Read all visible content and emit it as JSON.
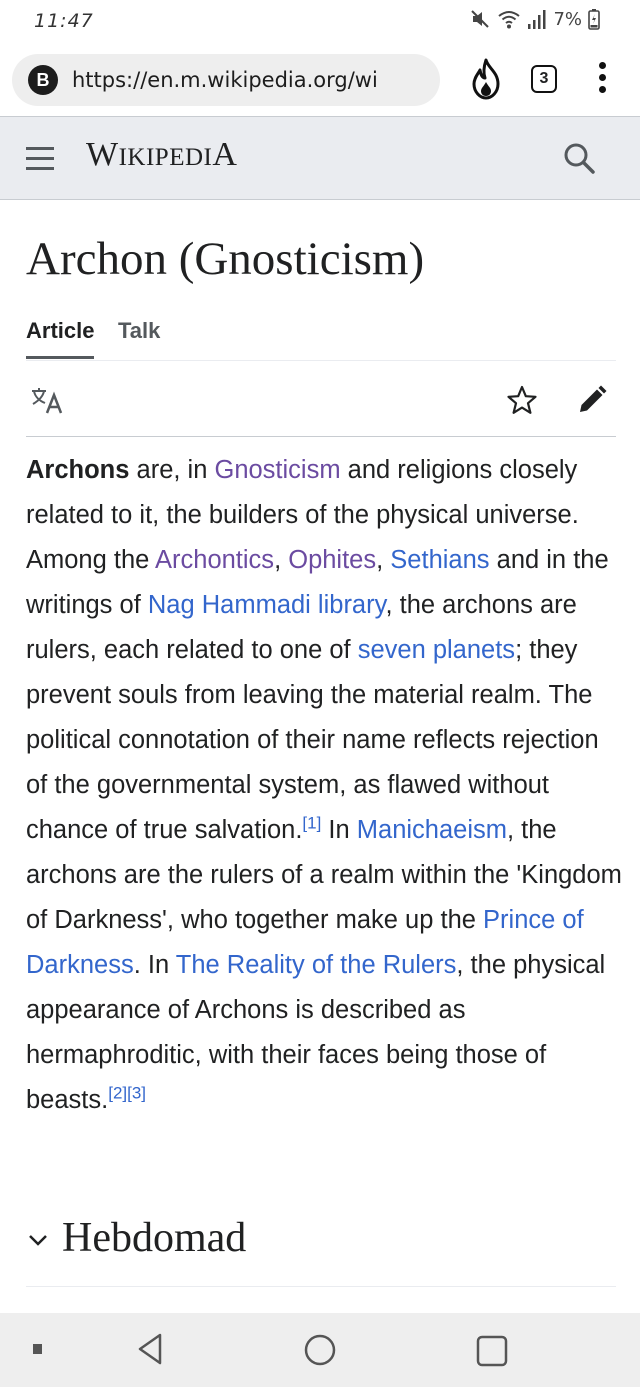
{
  "status": {
    "time": "11:47",
    "battery": "7%"
  },
  "browser": {
    "site_badge": "B",
    "url": "https://en.m.wikipedia.org/wi",
    "tab_count": "3"
  },
  "header": {
    "wordmark_first": "W",
    "wordmark_rest": "IKIPEDI",
    "wordmark_last": "A"
  },
  "page": {
    "title": "Archon (Gnosticism)",
    "tabs": [
      {
        "label": "Article",
        "active": true
      },
      {
        "label": "Talk",
        "active": false
      }
    ]
  },
  "content": {
    "segments": [
      {
        "text": "Archons",
        "bold": true
      },
      {
        "text": " are, in "
      },
      {
        "text": "Gnosticism",
        "link": true,
        "visited": true
      },
      {
        "text": " and religions closely related to it, the builders of the physical universe. Among the "
      },
      {
        "text": "Archontics",
        "link": true,
        "visited": true
      },
      {
        "text": ", "
      },
      {
        "text": "Ophites",
        "link": true,
        "visited": true
      },
      {
        "text": ", "
      },
      {
        "text": "Sethians",
        "link": true
      },
      {
        "text": " and in the writings of "
      },
      {
        "text": "Nag Hammadi library",
        "link": true
      },
      {
        "text": ", the archons are rulers, each related to one of "
      },
      {
        "text": "seven planets",
        "link": true
      },
      {
        "text": "; they prevent souls from leaving the material realm. The political connotation of their name reflects rejection of the governmental system, as flawed without chance of true salvation."
      },
      {
        "text": "[1]",
        "ref": true
      },
      {
        "text": " In "
      },
      {
        "text": "Manichaeism",
        "link": true
      },
      {
        "text": ", the archons are the rulers of a realm within the 'Kingdom of Darkness', who together make up the "
      },
      {
        "text": "Prince of Darkness",
        "link": true
      },
      {
        "text": ". In "
      },
      {
        "text": "The Reality of the Rulers",
        "link": true
      },
      {
        "text": ", the physical appearance of Archons is described as hermaphroditic, with their faces being those of beasts."
      },
      {
        "text": "[2]",
        "ref": true
      },
      {
        "text": "[3]",
        "ref": true
      }
    ]
  },
  "section": {
    "heading": "Hebdomad"
  },
  "colors": {
    "link": "#3366cc",
    "visited_link": "#6b4ba1",
    "header_bg": "#eaecf0",
    "text": "#202122"
  },
  "icons": {
    "mute": "mute-icon",
    "wifi": "wifi-icon",
    "signal": "signal-icon",
    "battery": "battery-icon",
    "fire": "fire-icon",
    "menu": "menu-icon",
    "search": "search-icon",
    "language": "language-icon",
    "watch": "star-icon",
    "edit": "pencil-icon",
    "collapse": "chevron-down-icon",
    "back": "back-icon",
    "home": "home-icon",
    "recents": "recents-icon"
  }
}
